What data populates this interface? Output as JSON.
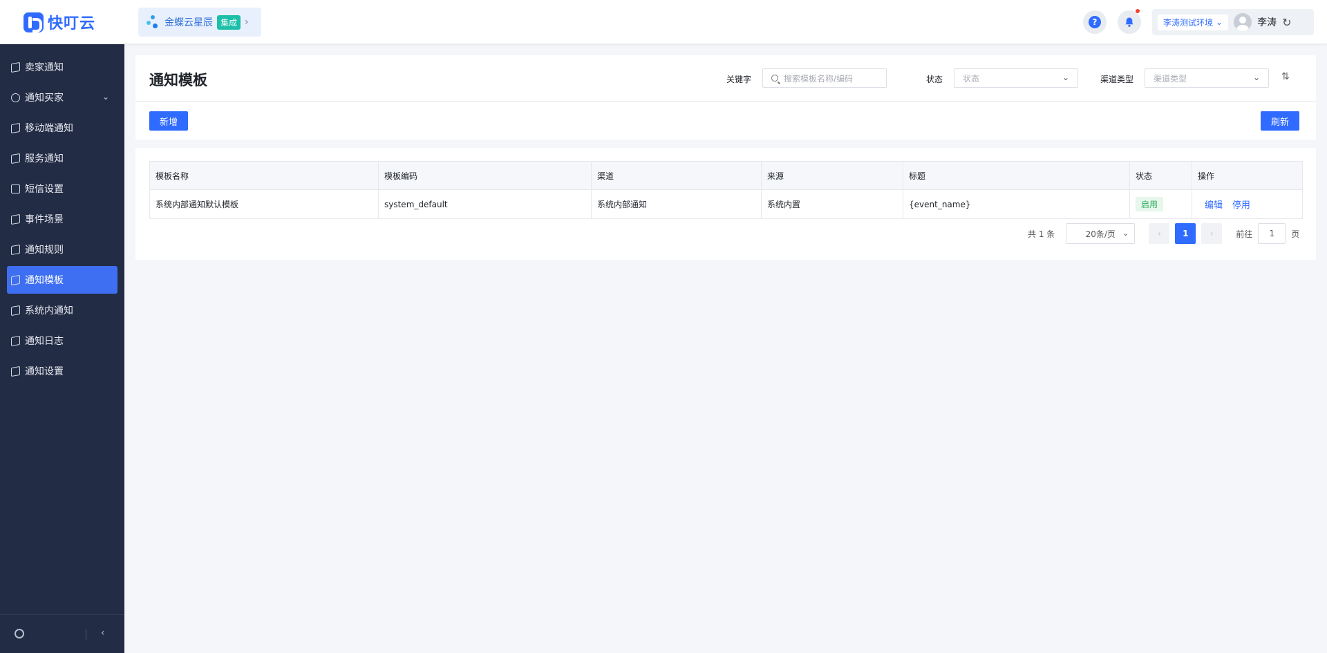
{
  "app": {
    "logo_text": "快叮云",
    "product": {
      "name": "金蝶云星辰",
      "tag": "集成"
    },
    "env": "李涛测试环境",
    "user": "李涛",
    "accent_color": "#2f6bff"
  },
  "sidebar": {
    "items": [
      {
        "label": "卖家通知",
        "icon": "doc-icon"
      },
      {
        "label": "通知买家",
        "icon": "chat-icon",
        "has_submenu": true
      },
      {
        "label": "移动端通知",
        "icon": "doc-icon"
      },
      {
        "label": "服务通知",
        "icon": "doc-icon"
      },
      {
        "label": "短信设置",
        "icon": "mail-icon"
      },
      {
        "label": "事件场景",
        "icon": "doc-icon"
      },
      {
        "label": "通知规则",
        "icon": "doc-icon"
      },
      {
        "label": "通知模板",
        "icon": "doc-icon",
        "active": true
      },
      {
        "label": "系统内通知",
        "icon": "doc-icon"
      },
      {
        "label": "通知日志",
        "icon": "doc-icon"
      },
      {
        "label": "通知设置",
        "icon": "doc-icon"
      }
    ]
  },
  "page": {
    "title": "通知模板",
    "filters": {
      "keyword_label": "关键字",
      "keyword_placeholder": "搜索模板名称/编码",
      "status_label": "状态",
      "status_placeholder": "状态",
      "channel_label": "渠道类型",
      "channel_placeholder": "渠道类型"
    },
    "add_label": "新增",
    "refresh_label": "刷新"
  },
  "table": {
    "columns": [
      "模板名称",
      "模板编码",
      "渠道",
      "来源",
      "标题",
      "状态",
      "操作"
    ],
    "rows": [
      {
        "name": "系统内部通知默认模板",
        "code": "system_default",
        "channel": "系统内部通知",
        "source": "系统内置",
        "title": "{event_name}",
        "status": "启用",
        "actions": [
          "编辑",
          "停用"
        ]
      }
    ]
  },
  "pagination": {
    "total_text": "共 1 条",
    "page_size": "20条/页",
    "current_page": "1",
    "goto_label": "前往",
    "goto_value": "1",
    "page_suffix": "页"
  }
}
